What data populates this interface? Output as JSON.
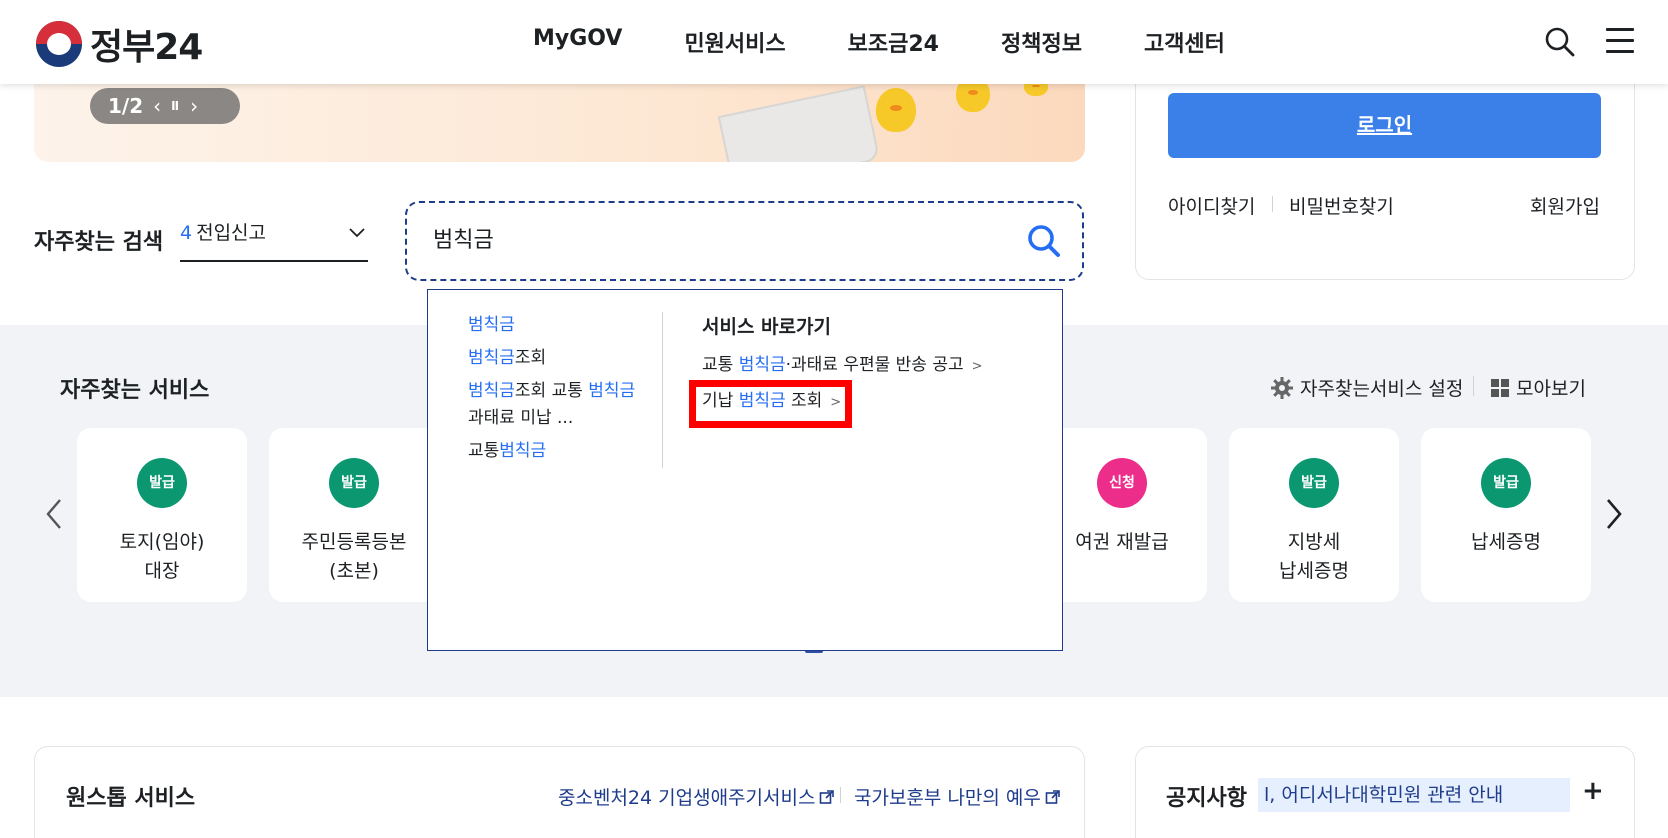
{
  "header": {
    "logo_text": "정부24",
    "nav": [
      "MyGOV",
      "민원서비스",
      "보조금24",
      "정책정보",
      "고객센터"
    ]
  },
  "banner": {
    "pager_count": "1/2",
    "prev": "‹",
    "pause": "II",
    "next": "›"
  },
  "search": {
    "fav_label": "자주찾는 검색",
    "fav_rank": "4",
    "fav_keyword": "전입신고",
    "query": "범칙금"
  },
  "dropdown": {
    "suggestions": [
      {
        "hl": "범칙금",
        "rest": "",
        "hl2": "",
        "rest2": ""
      },
      {
        "hl": "범칙금",
        "rest": "조회",
        "hl2": "",
        "rest2": ""
      },
      {
        "hl": "범칙금",
        "rest": "조회 교통 ",
        "hl2": "범칙금",
        "rest2": " 과태료 미납 ..."
      },
      {
        "pre": "교통",
        "hl": "범칙금",
        "rest": "",
        "hl2": "",
        "rest2": ""
      }
    ],
    "right_title": "서비스 바로가기",
    "links": [
      {
        "pre": "교통 ",
        "hl": "범칙금",
        "post": "·과태료 우편물 반송 공고"
      },
      {
        "pre": "기납 ",
        "hl": "범칙금",
        "post": " 조회"
      }
    ]
  },
  "login": {
    "button": "로그인",
    "find_id": "아이디찾기",
    "find_pw": "비밀번호찾기",
    "signup": "회원가입"
  },
  "frequent": {
    "title": "자주찾는 서비스",
    "settings": "자주찾는서비스 설정",
    "view_all": "모아보기",
    "cards": [
      {
        "badge": "발급",
        "name": "토지(임야)\n대장",
        "color": "#0b9870"
      },
      {
        "badge": "발급",
        "name": "주민등록등본\n(초본)",
        "color": "#0b9870"
      },
      {
        "badge": "신청",
        "name": "여권 재발급",
        "color": "#ec2d8a"
      },
      {
        "badge": "발급",
        "name": "지방세\n납세증명",
        "color": "#0b9870"
      },
      {
        "badge": "발급",
        "name": "납세증명",
        "color": "#0b9870"
      }
    ]
  },
  "onestop": {
    "title": "원스톱 서비스",
    "link1": "중소벤처24 기업생애주기서비스",
    "link2": "국가보훈부 나만의 예우"
  },
  "notice": {
    "title": "공지사항",
    "marquee": "l, 어디서나대학민원 관련 안내",
    "plus": "+"
  }
}
